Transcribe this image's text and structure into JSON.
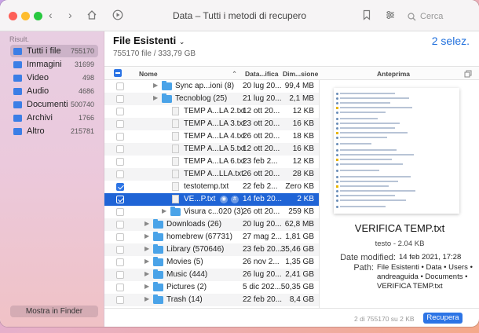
{
  "window": {
    "title": "Data – Tutti i metodi di recupero"
  },
  "search": {
    "placeholder": "Cerca"
  },
  "sidebar": {
    "section_label": "Risult.",
    "items": [
      {
        "label": "Tutti i file",
        "count": "755170",
        "selected": true
      },
      {
        "label": "Immagini",
        "count": "31699"
      },
      {
        "label": "Video",
        "count": "498"
      },
      {
        "label": "Audio",
        "count": "4686"
      },
      {
        "label": "Documenti",
        "count": "500740"
      },
      {
        "label": "Archivi",
        "count": "1766"
      },
      {
        "label": "Altro",
        "count": "215781"
      }
    ],
    "finder_button": "Mostra in Finder"
  },
  "main": {
    "title": "File Esistenti",
    "subtitle": "755170 file / 333,79 GB",
    "selected_count": "2 selez."
  },
  "columns": {
    "name": "Nome",
    "date": "Data...ifica",
    "size": "Dim...sione",
    "preview": "Anteprima"
  },
  "rows": [
    {
      "type": "folder",
      "indent": 1,
      "name": "Sync ap...ioni (8)",
      "date": "20 lug 20...",
      "size": "99,4 MB",
      "checked": false
    },
    {
      "type": "folder",
      "indent": 1,
      "name": "Tecnoblog (25)",
      "date": "21 lug 20...",
      "size": "2,1 MB",
      "checked": false
    },
    {
      "type": "file",
      "indent": 2,
      "name": "TEMP A...LA 2.txt",
      "date": "12 ott 20...",
      "size": "12 KB",
      "checked": false
    },
    {
      "type": "file",
      "indent": 2,
      "name": "TEMP A...LA 3.txt",
      "date": "23 ott 20...",
      "size": "16 KB",
      "checked": false
    },
    {
      "type": "file",
      "indent": 2,
      "name": "TEMP A...LA 4.txt",
      "date": "26 ott 20...",
      "size": "18 KB",
      "checked": false
    },
    {
      "type": "file",
      "indent": 2,
      "name": "TEMP A...LA 5.txt",
      "date": "12 ott 20...",
      "size": "16 KB",
      "checked": false
    },
    {
      "type": "file",
      "indent": 2,
      "name": "TEMP A...LA 6.txt",
      "date": "23 feb 2...",
      "size": "12 KB",
      "checked": false
    },
    {
      "type": "file",
      "indent": 2,
      "name": "TEMP A...LLA.txt",
      "date": "26 ott 20...",
      "size": "28 KB",
      "checked": false
    },
    {
      "type": "file",
      "indent": 2,
      "name": "testotemp.txt",
      "date": "22 feb 2...",
      "size": "Zero KB",
      "checked": true
    },
    {
      "type": "file",
      "indent": 2,
      "name": "VE...P.txt",
      "date": "14 feb 20...",
      "size": "2 KB",
      "checked": true,
      "highlight": true
    },
    {
      "type": "folder",
      "indent": 2,
      "name": "Visura c...020 (3)",
      "date": "26 ott 20...",
      "size": "259 KB",
      "checked": false
    },
    {
      "type": "folder",
      "indent": 0,
      "name": "Downloads (26)",
      "date": "20 lug 20...",
      "size": "62,8 MB",
      "checked": false
    },
    {
      "type": "folder",
      "indent": 0,
      "name": "homebrew (67731)",
      "date": "27 mag 2...",
      "size": "1,81 GB",
      "checked": false
    },
    {
      "type": "folder",
      "indent": 0,
      "name": "Library (570646)",
      "date": "23 feb 20...",
      "size": "35,46 GB",
      "checked": false
    },
    {
      "type": "folder",
      "indent": 0,
      "name": "Movies (5)",
      "date": "26 nov 2...",
      "size": "1,35 GB",
      "checked": false
    },
    {
      "type": "folder",
      "indent": 0,
      "name": "Music (444)",
      "date": "26 lug 20...",
      "size": "2,41 GB",
      "checked": false
    },
    {
      "type": "folder",
      "indent": 0,
      "name": "Pictures (2)",
      "date": "5 dic 202...",
      "size": "50,35 GB",
      "checked": false
    },
    {
      "type": "folder",
      "indent": 0,
      "name": "Trash (14)",
      "date": "22 feb 20...",
      "size": "8,4 GB",
      "checked": false
    }
  ],
  "preview": {
    "file_name": "VERIFICA TEMP.txt",
    "meta": "testo - 2.04 KB",
    "modified_label": "Date modified:",
    "modified_value": "14 feb 2021, 17:28",
    "path_label": "Path:",
    "path_line1": "File Esistenti • Data • Users •",
    "path_line2": "andreaguida • Documents •",
    "path_line3": "VERIFICA TEMP.txt"
  },
  "footer": {
    "summary": "2 di 755170 su 2 KB",
    "recover_button": "Recupera"
  },
  "colors": {
    "accent": "#2c74e5",
    "highlight_row": "#1f64d6",
    "folder": "#4aa3e8"
  }
}
